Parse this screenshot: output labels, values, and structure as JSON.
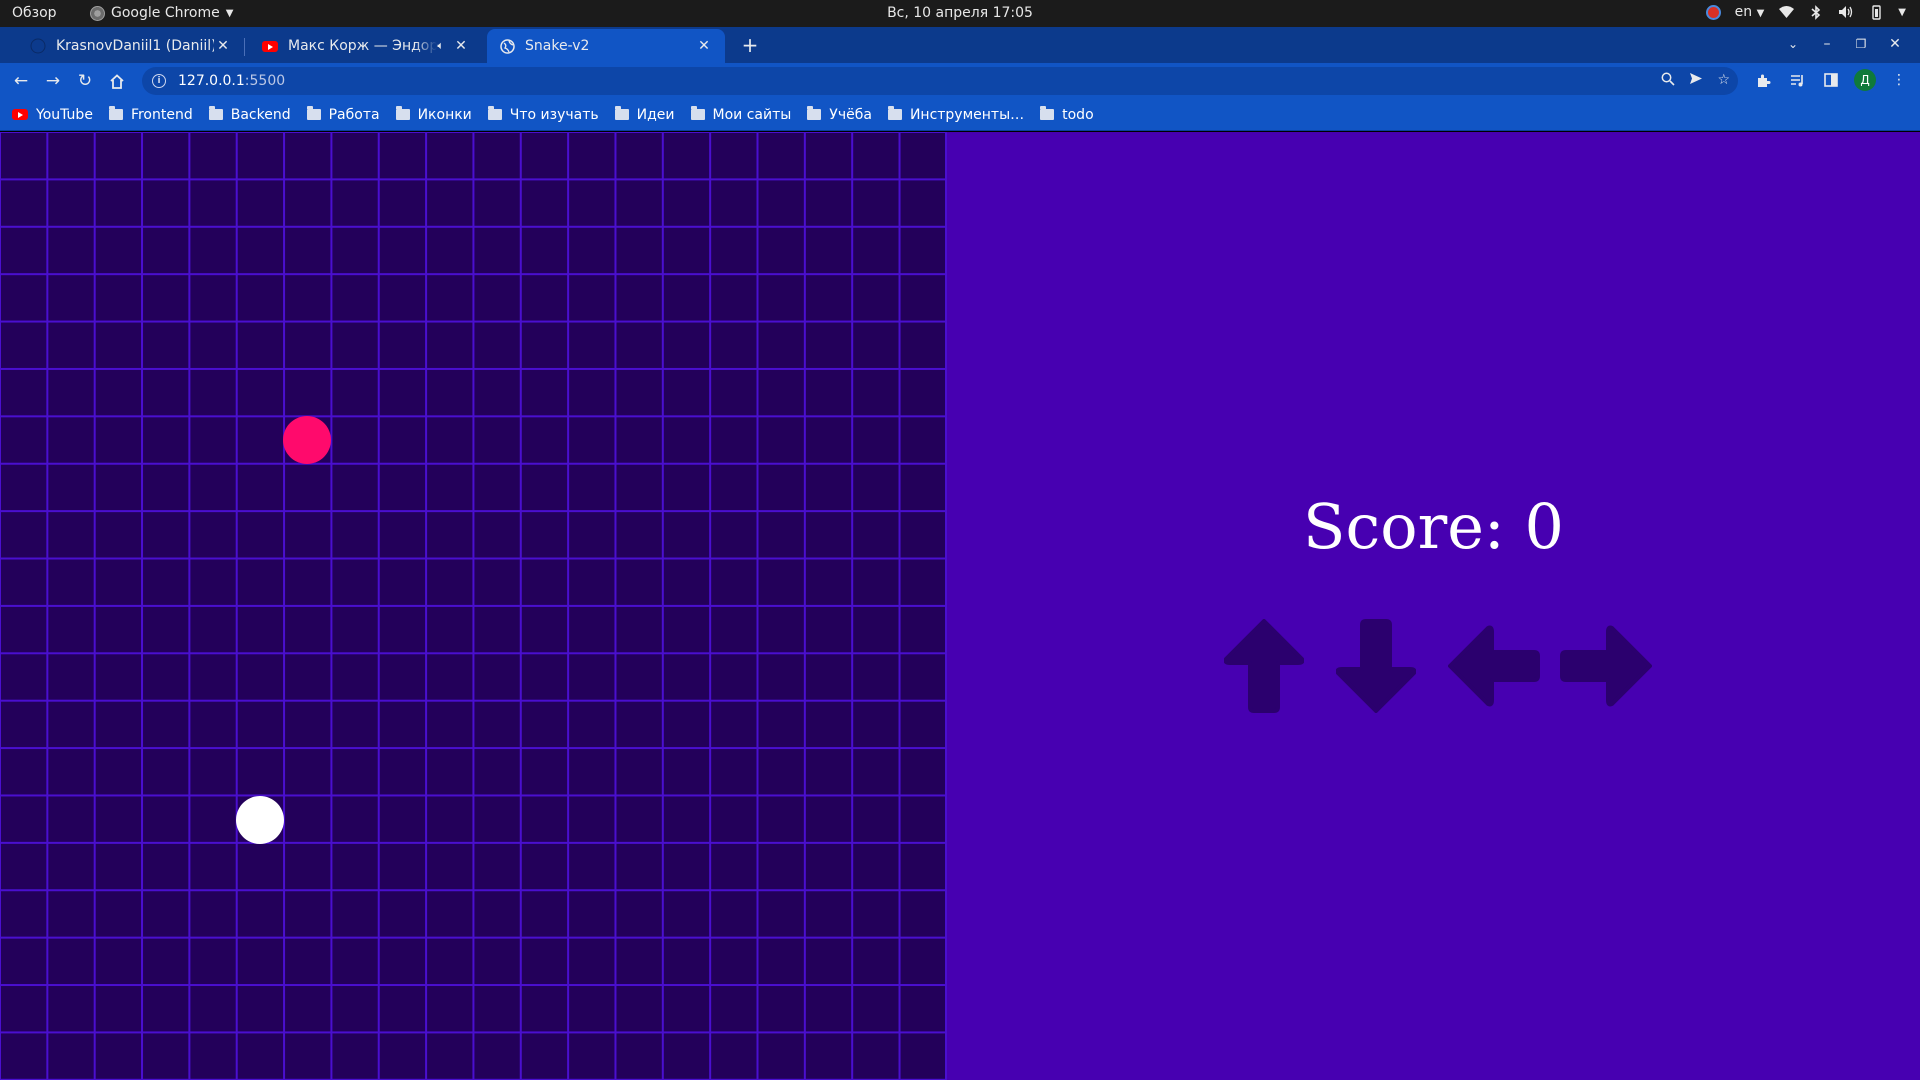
{
  "system_bar": {
    "overview": "Обзор",
    "app_name": "Google Chrome",
    "clock": "Вс, 10 апреля  17:05",
    "language": "en"
  },
  "tabs": [
    {
      "title": "KrasnovDaniil1 (Daniil)",
      "icon": "github-icon",
      "active": false
    },
    {
      "title": "Макс Корж — Эндорфин",
      "icon": "youtube-icon",
      "active": false,
      "audio": true
    },
    {
      "title": "Snake-v2",
      "icon": "globe-icon",
      "active": true
    }
  ],
  "toolbar": {
    "url_host": "127.0.0.1",
    "url_port": ":5500"
  },
  "bookmarks": [
    {
      "label": "YouTube",
      "icon": "youtube-icon"
    },
    {
      "label": "Frontend",
      "icon": "folder-icon"
    },
    {
      "label": "Backend",
      "icon": "folder-icon"
    },
    {
      "label": "Работа",
      "icon": "folder-icon"
    },
    {
      "label": "Иконки",
      "icon": "folder-icon"
    },
    {
      "label": "Что изучать",
      "icon": "folder-icon"
    },
    {
      "label": "Идеи",
      "icon": "folder-icon"
    },
    {
      "label": "Мои сайты",
      "icon": "folder-icon"
    },
    {
      "label": "Учёба",
      "icon": "folder-icon"
    },
    {
      "label": "Инструменты…",
      "icon": "folder-icon"
    },
    {
      "label": "todo",
      "icon": "folder-icon"
    }
  ],
  "profile": {
    "initial": "Д"
  },
  "game": {
    "score_text": "Score: 0",
    "colors": {
      "board": "#23005a",
      "grid_line": "#4a0fcf",
      "side_panel": "#4700b1",
      "food": "#ff0a6c",
      "snake": "#ffffff",
      "arrow": "#2b006e"
    },
    "controls": [
      "arrow-up-icon",
      "arrow-down-icon",
      "arrow-left-icon",
      "arrow-right-icon"
    ]
  }
}
